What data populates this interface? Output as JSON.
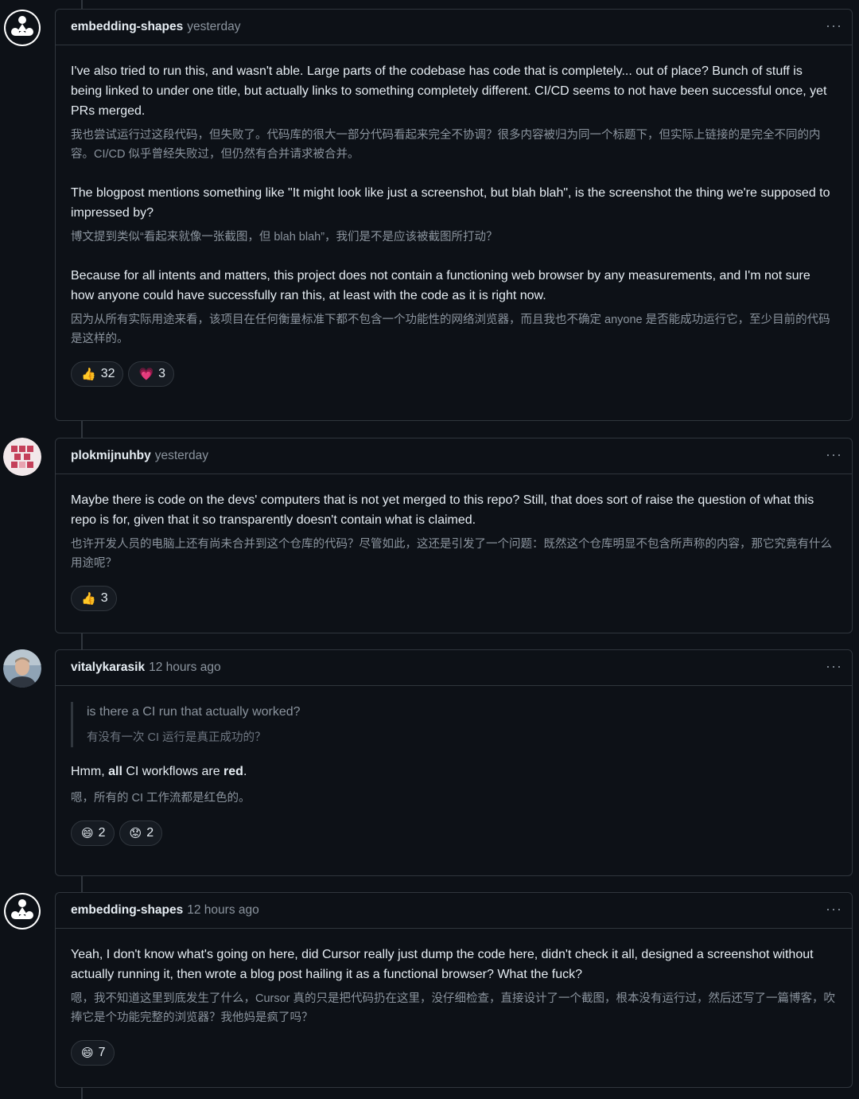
{
  "comments": [
    {
      "author": "embedding-shapes",
      "time": "yesterday",
      "paragraphs": [
        {
          "en": "I've also tried to run this, and wasn't able. Large parts of the codebase has code that is completely... out of place? Bunch of stuff is being linked to under one title, but actually links to something completely different. CI/CD seems to not have been successful once, yet PRs merged.",
          "zh": "我也尝试运行过这段代码，但失败了。代码库的很大一部分代码看起来完全不协调？很多内容被归为同一个标题下，但实际上链接的是完全不同的内容。CI/CD 似乎曾经失败过，但仍然有合并请求被合并。"
        },
        {
          "en": "The blogpost mentions something like \"It might look like just a screenshot, but blah blah\", is the screenshot the thing we're supposed to impressed by?",
          "zh": "博文提到类似“看起来就像一张截图，但 blah blah”，我们是不是应该被截图所打动？"
        },
        {
          "en": "Because for all intents and matters, this project does not contain a functioning web browser by any measurements, and I'm not sure how anyone could have successfully ran this, at least with the code as it is right now.",
          "zh": "因为从所有实际用途来看，该项目在任何衡量标准下都不包含一个功能性的网络浏览器，而且我也不确定 anyone 是否能成功运行它，至少目前的代码是这样的。"
        }
      ],
      "reactions": [
        {
          "emoji": "👍",
          "count": "32"
        },
        {
          "emoji": "💗",
          "count": "3"
        }
      ]
    },
    {
      "author": "plokmijnuhby",
      "time": "yesterday",
      "paragraphs": [
        {
          "en": "Maybe there is code on the devs' computers that is not yet merged to this repo? Still, that does sort of raise the question of what this repo is for, given that it so transparently doesn't contain what is claimed.",
          "zh": "也许开发人员的电脑上还有尚未合并到这个仓库的代码？尽管如此，这还是引发了一个问题：既然这个仓库明显不包含所声称的内容，那它究竟有什么用途呢？"
        }
      ],
      "reactions": [
        {
          "emoji": "👍",
          "count": "3"
        }
      ]
    },
    {
      "author": "vitalykarasik",
      "time": "12 hours ago",
      "quote": {
        "en": "is there a CI run that actually worked?",
        "zh": "有没有一次 CI 运行是真正成功的？"
      },
      "body": {
        "pre": "Hmm, ",
        "bold1": "all",
        "mid": " CI workflows are ",
        "bold2": "red",
        "post": ".",
        "zh": "嗯，所有的 CI 工作流都是红色的。"
      },
      "reactions": [
        {
          "emoji": "😄",
          "count": "2"
        },
        {
          "emoji": "😟",
          "count": "2"
        }
      ]
    },
    {
      "author": "embedding-shapes",
      "time": "12 hours ago",
      "paragraphs": [
        {
          "en": "Yeah, I don't know what's going on here, did Cursor really just dump the code here, didn't check it all, designed a screenshot without actually running it, then wrote a blog post hailing it as a functional browser? What the fuck?",
          "zh": "嗯，我不知道这里到底发生了什么，Cursor 真的只是把代码扔在这里，没仔细检查，直接设计了一个截图，根本没有运行过，然后还写了一篇博客，吹捧它是个功能完整的浏览器？我他妈是疯了吗？"
        }
      ],
      "reactions": [
        {
          "emoji": "😄",
          "count": "7"
        }
      ]
    }
  ],
  "ui": {
    "kebab": "···"
  }
}
